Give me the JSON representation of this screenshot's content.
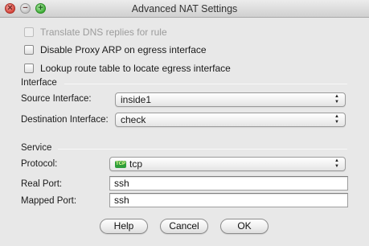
{
  "window": {
    "title": "Advanced NAT Settings"
  },
  "options": [
    {
      "label": "Translate DNS replies for rule",
      "checked": false,
      "enabled": false
    },
    {
      "label": "Disable Proxy ARP on egress interface",
      "checked": false,
      "enabled": true
    },
    {
      "label": "Lookup route table to locate egress interface",
      "checked": false,
      "enabled": true
    }
  ],
  "interface": {
    "section_title": "Interface",
    "source_label": "Source Interface:",
    "source_value": "inside1",
    "destination_label": "Destination Interface:",
    "destination_value": "check"
  },
  "service": {
    "section_title": "Service",
    "protocol_label": "Protocol:",
    "protocol_icon_text": "TCP",
    "protocol_value": "tcp",
    "real_port_label": "Real Port:",
    "real_port_value": "ssh",
    "mapped_port_label": "Mapped Port:",
    "mapped_port_value": "ssh"
  },
  "buttons": {
    "help": "Help",
    "cancel": "Cancel",
    "ok": "OK"
  }
}
